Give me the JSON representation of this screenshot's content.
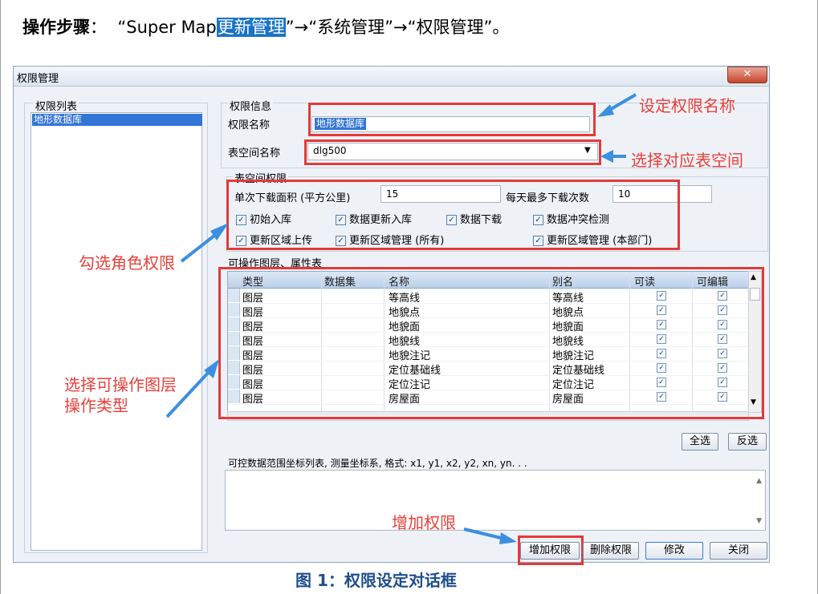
{
  "instruction": {
    "label": "操作步骤",
    "sep": "：",
    "part1": "“Super Map",
    "highlight": "更新管理",
    "part2": "”→“系统管理”→“权限管理”。"
  },
  "dialog": {
    "title": "权限管理",
    "close_glyph": "✕",
    "perm_list": {
      "label": "权限列表",
      "items": [
        "地形数据库"
      ]
    },
    "perm_info": {
      "section": "权限信息",
      "name_label": "权限名称",
      "name_value": "地形数据库",
      "space_label": "表空间名称",
      "space_value": "dlg500",
      "space_perm_section": "表空间权限",
      "area_label": "单次下载面积 (平方公里)",
      "area_value": "15",
      "count_label": "每天最多下载次数",
      "count_value": "10",
      "checks": [
        {
          "label": "初始入库",
          "checked": true
        },
        {
          "label": "数据更新入库",
          "checked": true
        },
        {
          "label": "数据下载",
          "checked": true
        },
        {
          "label": "数据冲突检测",
          "checked": true
        },
        {
          "label": "更新区域上传",
          "checked": true
        },
        {
          "label": "更新区域管理 (所有)",
          "checked": true
        },
        {
          "label": "更新区域管理 (本部门)",
          "checked": true
        }
      ]
    },
    "layers": {
      "section": "可操作图层、属性表",
      "columns": [
        "类型",
        "数据集",
        "名称",
        "别名",
        "可读",
        "可编辑"
      ],
      "rows": [
        {
          "type": "图层",
          "dataset": "",
          "name": "等高线",
          "alias": "等高线",
          "read": true,
          "edit": true
        },
        {
          "type": "图层",
          "dataset": "",
          "name": "地貌点",
          "alias": "地貌点",
          "read": true,
          "edit": true
        },
        {
          "type": "图层",
          "dataset": "",
          "name": "地貌面",
          "alias": "地貌面",
          "read": true,
          "edit": true
        },
        {
          "type": "图层",
          "dataset": "",
          "name": "地貌线",
          "alias": "地貌线",
          "read": true,
          "edit": true
        },
        {
          "type": "图层",
          "dataset": "",
          "name": "地貌注记",
          "alias": "地貌注记",
          "read": true,
          "edit": true
        },
        {
          "type": "图层",
          "dataset": "",
          "name": "定位基础线",
          "alias": "定位基础线",
          "read": true,
          "edit": true
        },
        {
          "type": "图层",
          "dataset": "",
          "name": "定位注记",
          "alias": "定位注记",
          "read": true,
          "edit": true
        },
        {
          "type": "图层",
          "dataset": "",
          "name": "房屋面",
          "alias": "房屋面",
          "read": true,
          "edit": true
        }
      ],
      "select_all": "全选",
      "invert": "反选"
    },
    "range": {
      "label": "可控数据范围坐标列表, 测量坐标系, 格式: x1, y1, x2, y2, xn, yn. . ."
    },
    "buttons": {
      "add": "增加权限",
      "delete": "删除权限",
      "modify": "修改",
      "close": "关闭"
    }
  },
  "annotations": {
    "set_name": "设定权限名称",
    "select_space": "选择对应表空间",
    "check_role": "勾选角色权限",
    "select_layer": "选择可操作图层",
    "select_layer2": "操作类型",
    "add_perm": "增加权限"
  },
  "caption": "图 1：权限设定对话框",
  "colors": {
    "highlight": "#1a73c7",
    "annotation": "#e8403a",
    "arrow": "#3b8fe0",
    "caption": "#1f4e8c"
  }
}
